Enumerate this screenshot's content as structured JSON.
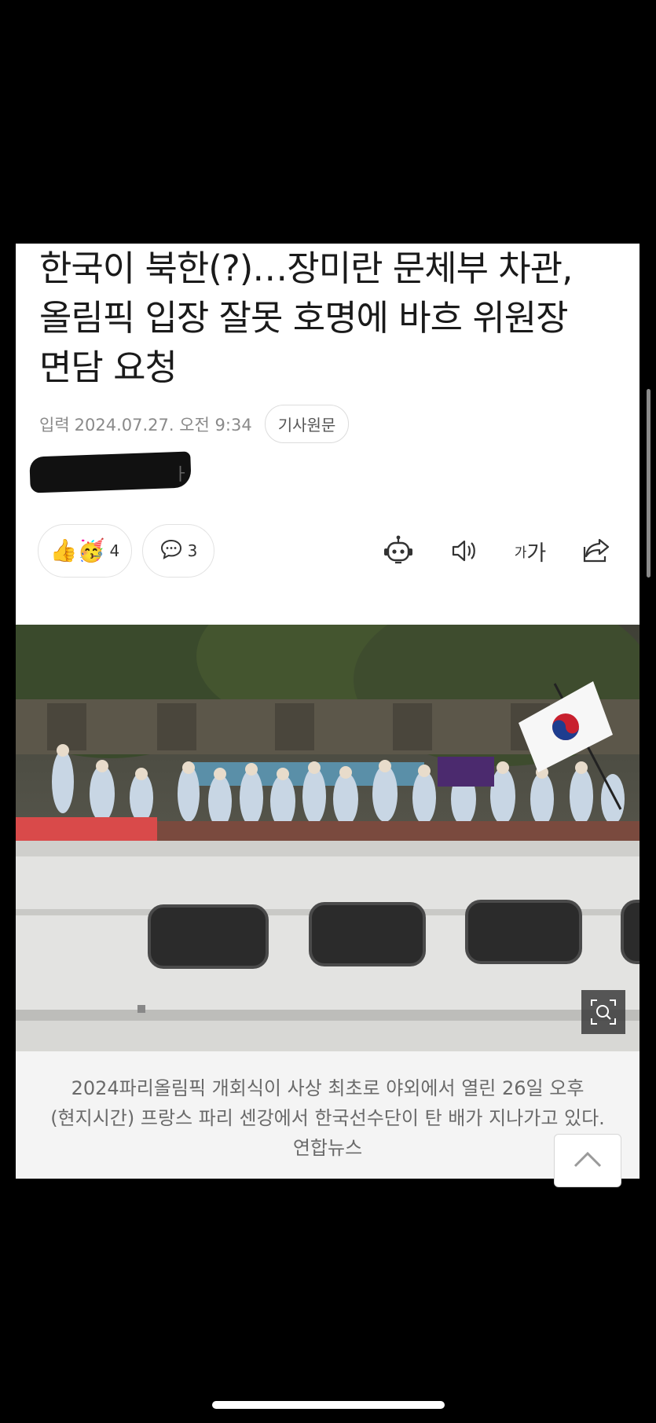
{
  "article": {
    "title": "한국이 북한(?)…장미란 문체부 차관, 올림픽 입장 잘못 호명에 바흐 위원장 면담 요청",
    "date_label": "입력",
    "date": "2024.07.27. 오전 9:34",
    "original_button": "기사원문",
    "reporter_tail": "ㅏ",
    "reaction_count": "4",
    "comment_count": "3",
    "font_size_small": "가",
    "font_size_large": "가",
    "caption": "2024파리올림픽 개회식이 사상 최초로 야외에서 열린 26일 오후(현지시간) 프랑스 파리 센강에서 한국선수단이 탄 배가 지나가고 있다. 연합뉴스"
  },
  "icons": {
    "reaction": "thumbs-up-icon",
    "comment": "comment-icon",
    "summary_bot": "robot-icon",
    "read_aloud": "speaker-icon",
    "font_size": "font-size-icon",
    "share": "share-icon",
    "zoom": "zoom-icon",
    "top": "chevron-up-icon"
  }
}
